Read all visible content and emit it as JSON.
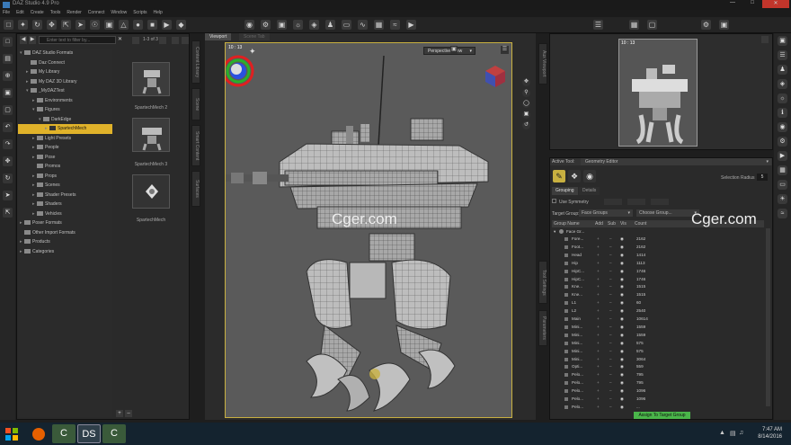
{
  "window": {
    "title": "DAZ Studio 4.9 Pro"
  },
  "menu": [
    "File",
    "Edit",
    "Create",
    "Tools",
    "Render",
    "Connect",
    "Window",
    "Scripts",
    "Help"
  ],
  "content_library": {
    "search_placeholder": "Enter text to filter by...",
    "page_indicator": "1-3 of 3",
    "tree": [
      {
        "label": "DAZ Studio Formats",
        "level": 0,
        "arrow": "▾"
      },
      {
        "label": "Daz Connect",
        "level": 1,
        "arrow": ""
      },
      {
        "label": "My Library",
        "level": 1,
        "arrow": "▸"
      },
      {
        "label": "My DAZ 3D Library",
        "level": 1,
        "arrow": "▸"
      },
      {
        "label": "_MyDAZTest",
        "level": 1,
        "arrow": "▾"
      },
      {
        "label": "Environments",
        "level": 2,
        "arrow": "▸"
      },
      {
        "label": "Figures",
        "level": 2,
        "arrow": "▾"
      },
      {
        "label": "DarkEdge",
        "level": 3,
        "arrow": "▾"
      },
      {
        "label": "SpartechMech",
        "level": 4,
        "arrow": "▸",
        "selected": true
      },
      {
        "label": "Light Presets",
        "level": 2,
        "arrow": "▸"
      },
      {
        "label": "People",
        "level": 2,
        "arrow": "▸"
      },
      {
        "label": "Pose",
        "level": 2,
        "arrow": "▸"
      },
      {
        "label": "Promos",
        "level": 2,
        "arrow": ""
      },
      {
        "label": "Props",
        "level": 2,
        "arrow": "▸"
      },
      {
        "label": "Scenes",
        "level": 2,
        "arrow": "▸"
      },
      {
        "label": "Shader Presets",
        "level": 2,
        "arrow": "▸"
      },
      {
        "label": "Shaders",
        "level": 2,
        "arrow": "▸"
      },
      {
        "label": "Vehicles",
        "level": 2,
        "arrow": "▸"
      },
      {
        "label": "Poser Formats",
        "level": 0,
        "arrow": "▸"
      },
      {
        "label": "Other Import Formats",
        "level": 0,
        "arrow": ""
      },
      {
        "label": "Products",
        "level": 0,
        "arrow": "▸"
      },
      {
        "label": "Categories",
        "level": 0,
        "arrow": "▸"
      }
    ],
    "thumbnails": [
      "SpartechMech 2",
      "SpartechMech 3",
      "SpartechMech"
    ]
  },
  "side_tabs_left": [
    "Content Library",
    "Scene",
    "Smart Content",
    "Surfaces"
  ],
  "viewport": {
    "tab": "Viewport",
    "tab2": "Scene Tab",
    "fps": "10 : 13",
    "camera": "Perspective View"
  },
  "aux_viewport": {
    "fps": "10 : 13",
    "tab": "Aux Viewport"
  },
  "geometry_editor": {
    "active_tool_label": "Active Tool:",
    "active_tool": "Geometry Editor",
    "selection_radius_label": "Selection Radius",
    "selection_radius_value": "5",
    "tabs": [
      "Grouping",
      "Details"
    ],
    "use_symmetry": "Use Symmetry",
    "target_group_label": "Target Group:",
    "target_group_value": "Face Groups",
    "choose_group": "Choose Group...",
    "columns": [
      "Group Name",
      "Add",
      "Sub",
      "Vis",
      "Count"
    ],
    "root_group": "Face Gr...",
    "rows": [
      {
        "name": "Fore...",
        "count": "2162"
      },
      {
        "name": "Foot...",
        "count": "2162"
      },
      {
        "name": "Head",
        "count": "1414"
      },
      {
        "name": "Hip",
        "count": "1113"
      },
      {
        "name": "HipC...",
        "count": "1746"
      },
      {
        "name": "HipC...",
        "count": "1746"
      },
      {
        "name": "Kne...",
        "count": "1515"
      },
      {
        "name": "Kne...",
        "count": "1515"
      },
      {
        "name": "L1",
        "count": "60"
      },
      {
        "name": "L2",
        "count": "2540"
      },
      {
        "name": "Main",
        "count": "10614"
      },
      {
        "name": "Mini...",
        "count": "1559"
      },
      {
        "name": "Mini...",
        "count": "1559"
      },
      {
        "name": "Mini...",
        "count": "575"
      },
      {
        "name": "Mini...",
        "count": "575"
      },
      {
        "name": "Mini...",
        "count": "3064"
      },
      {
        "name": "Opti...",
        "count": "559"
      },
      {
        "name": "Pelo...",
        "count": "795"
      },
      {
        "name": "Pelo...",
        "count": "795"
      },
      {
        "name": "Pelo...",
        "count": "1096"
      },
      {
        "name": "Pelo...",
        "count": "1096"
      },
      {
        "name": "Pelo...",
        "count": "..."
      }
    ],
    "assign_button": "Assign To Target Group"
  },
  "side_tabs_right": [
    "Aux Viewport",
    "Tool Settings",
    "Parameters"
  ],
  "watermark": "Cger.com",
  "taskbar": {
    "time": "7:47 AM",
    "date": "8/14/2016"
  }
}
